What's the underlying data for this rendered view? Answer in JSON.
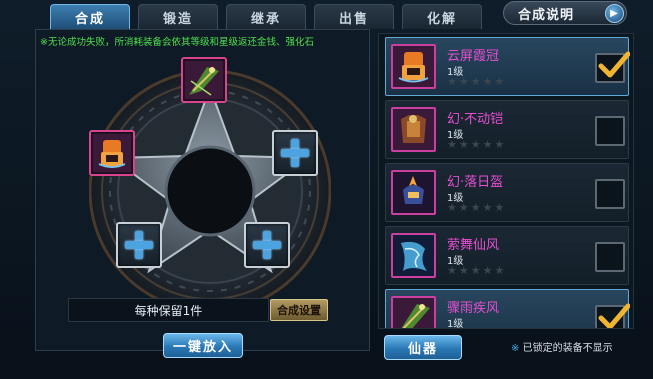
{
  "tabs": [
    {
      "label": "合成",
      "active": true
    },
    {
      "label": "锻造",
      "active": false
    },
    {
      "label": "继承",
      "active": false
    },
    {
      "label": "出售",
      "active": false
    },
    {
      "label": "化解",
      "active": false
    }
  ],
  "help_button": {
    "label": "合成说明",
    "arrow_icon": "play-arrow-icon"
  },
  "notice": "※无论成功失败，所消耗装备会依其等级和星级返还金钱、强化石",
  "slots": [
    {
      "position": "top",
      "state": "filled",
      "icon": "bow-equipment-icon"
    },
    {
      "position": "left",
      "state": "filled",
      "icon": "orange-helmet-icon"
    },
    {
      "position": "right",
      "state": "empty",
      "icon": "plus-icon"
    },
    {
      "position": "bottom-left",
      "state": "empty",
      "icon": "plus-icon"
    },
    {
      "position": "bottom-right",
      "state": "empty",
      "icon": "plus-icon"
    }
  ],
  "reserve_label": "每种保留1件",
  "settings_button": "合成设置",
  "one_click_button": "一键放入",
  "category_button": "仙器",
  "lock_note": {
    "prefix": "※",
    "text": "已锁定的装备不显示"
  },
  "items": [
    {
      "name": "云屏霞冠",
      "level": "1级",
      "stars": 5,
      "stars_filled": 0,
      "checked": true,
      "selected": true,
      "icon": "orange-helmet-icon"
    },
    {
      "name": "幻·不动铠",
      "level": "1级",
      "stars": 5,
      "stars_filled": 0,
      "checked": false,
      "selected": false,
      "icon": "armor-icon"
    },
    {
      "name": "幻·落日盔",
      "level": "1级",
      "stars": 5,
      "stars_filled": 0,
      "checked": false,
      "selected": false,
      "icon": "flame-helmet-icon"
    },
    {
      "name": "萦舞仙风",
      "level": "1级",
      "stars": 5,
      "stars_filled": 0,
      "checked": false,
      "selected": false,
      "icon": "blue-wind-icon"
    },
    {
      "name": "骤雨疾风",
      "level": "1级",
      "stars": 5,
      "stars_filled": 0,
      "checked": true,
      "selected": true,
      "icon": "bow-equipment-icon"
    }
  ],
  "colors": {
    "accent": "#3d7fb0",
    "notice": "#4fe04f",
    "item_name": "#e64fd1",
    "check": "#f0b430"
  }
}
